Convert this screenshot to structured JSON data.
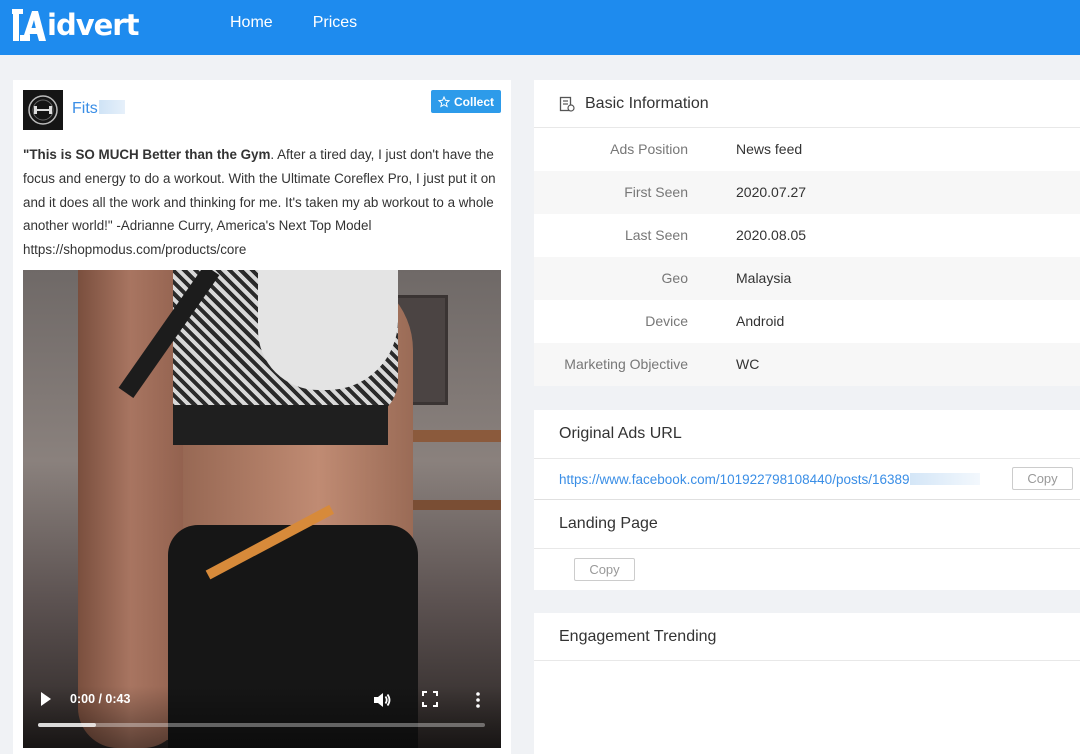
{
  "header": {
    "logo_text": "idvert",
    "nav": [
      {
        "label": "Home"
      },
      {
        "label": "Prices"
      }
    ]
  },
  "ad": {
    "advertiser_name": "Fits",
    "collect_label": "Collect",
    "text_bold": "\"This is SO MUCH Better than the Gym",
    "text_rest": ". After a tired day, I just don't have the focus and energy to do a workout. With the Ultimate Coreflex Pro, I just put it on and it does all the work and thinking for me. It's taken my ab workout to a whole another world!\" -Adrianne Curry, America's Next Top Model",
    "text_url": "https://shopmodus.com/products/core",
    "video": {
      "time": "0:00 / 0:43",
      "progress": 0.13
    }
  },
  "basic_info": {
    "title": "Basic Information",
    "rows": [
      {
        "label": "Ads Position",
        "value": "News feed"
      },
      {
        "label": "First Seen",
        "value": "2020.07.27"
      },
      {
        "label": "Last Seen",
        "value": "2020.08.05"
      },
      {
        "label": "Geo",
        "value": "Malaysia"
      },
      {
        "label": "Device",
        "value": "Android"
      },
      {
        "label": "Marketing Objective",
        "value": "WC"
      }
    ]
  },
  "original_url": {
    "title": "Original Ads URL",
    "url": "https://www.facebook.com/101922798108440/posts/16389",
    "copy_label": "Copy"
  },
  "landing_page": {
    "title": "Landing Page",
    "copy_label": "Copy"
  },
  "engagement": {
    "title": "Engagement Trending"
  },
  "colors": {
    "header_bg": "#1e8bee",
    "accent": "#2d9bea",
    "link": "#3a8ee6"
  }
}
